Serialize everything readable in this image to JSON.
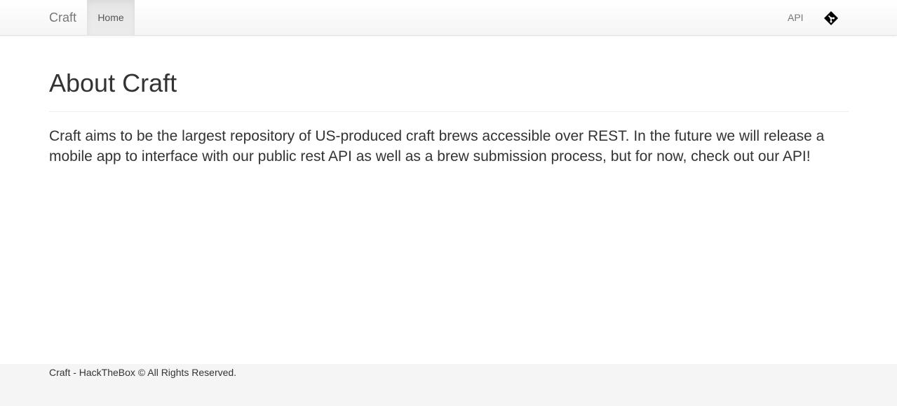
{
  "navbar": {
    "brand": "Craft",
    "items": [
      {
        "label": "Home",
        "active": true
      }
    ],
    "right_items": [
      {
        "label": "API"
      }
    ],
    "icon": "git-icon"
  },
  "main": {
    "title": "About Craft",
    "lead": "Craft aims to be the largest repository of US-produced craft brews accessible over REST. In the future we will release a mobile app to interface with our public rest API as well as a brew submission process, but for now, check out our API!"
  },
  "footer": {
    "text": "Craft - HackTheBox © All Rights Reserved."
  }
}
